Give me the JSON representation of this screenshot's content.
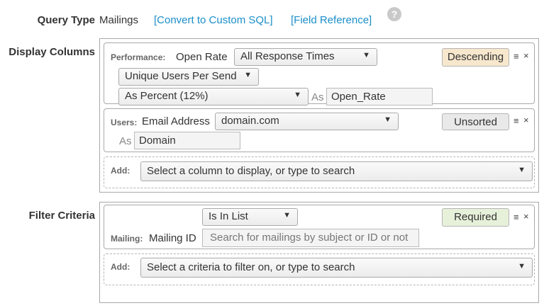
{
  "header": {
    "query_type_label": "Query Type",
    "query_type_value": "Mailings",
    "convert_link": "[Convert to Custom SQL]",
    "field_ref_link": "[Field Reference]",
    "help_glyph": "?"
  },
  "display_columns": {
    "label": "Display Columns",
    "col1": {
      "category": "Performance:",
      "field": "Open Rate",
      "response_select": "All Response Times",
      "users_select": "Unique Users Per Send",
      "format_select": "As Percent (12%)",
      "as_label": "As",
      "alias": "Open_Rate",
      "sort": "Descending"
    },
    "col2": {
      "category": "Users:",
      "field": "Email Address",
      "domain_select": "domain.com",
      "as_label": "As",
      "alias": "Domain",
      "sort": "Unsorted"
    },
    "add": {
      "label": "Add:",
      "placeholder": "Select a column to display, or type to search"
    }
  },
  "filter_criteria": {
    "label": "Filter Criteria",
    "filter1": {
      "operator_select": "Is In List",
      "category": "Mailing:",
      "field": "Mailing ID",
      "search_placeholder": "Search for mailings by subject or ID or not",
      "badge": "Required"
    },
    "add": {
      "label": "Add:",
      "placeholder": "Select a criteria to filter on, or type to search"
    }
  },
  "controls": {
    "menu_glyph": "≡",
    "close_glyph": "×",
    "dropdown_glyph": "▼"
  },
  "colors": {
    "link": "#1a8fc9",
    "descending_bg": "#f7e7cd",
    "unsorted_bg": "#e9e9e9",
    "required_bg": "#e7f1da"
  }
}
